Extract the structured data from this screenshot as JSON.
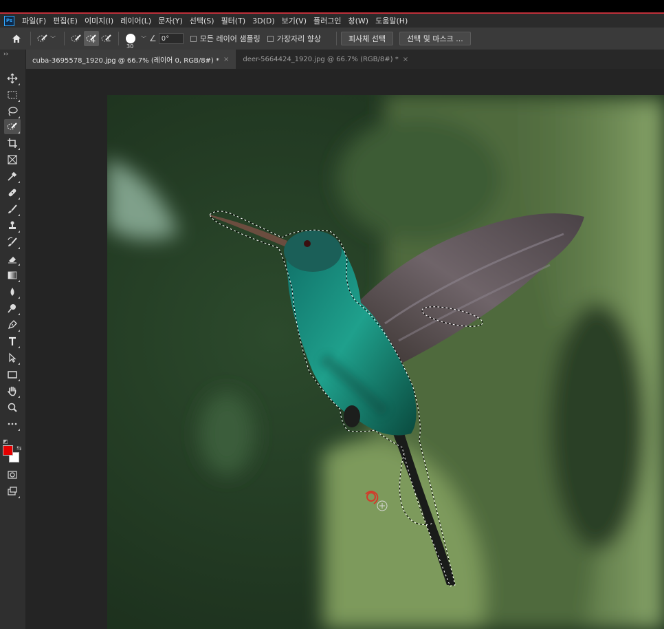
{
  "app": {
    "logo": "Ps"
  },
  "menu": [
    "파일(F)",
    "편집(E)",
    "이미지(I)",
    "레이어(L)",
    "문자(Y)",
    "선택(S)",
    "필터(T)",
    "3D(D)",
    "보기(V)",
    "플러그인",
    "창(W)",
    "도움말(H)"
  ],
  "options": {
    "brush_size": "30",
    "angle": "0°",
    "sample_all_layers": "모든 레이어 샘플링",
    "enhance_edge": "가장자리 향상",
    "select_subject": "피사체 선택",
    "select_and_mask": "선택 및 마스크 ..."
  },
  "tabs": [
    {
      "title": "cuba-3695578_1920.jpg @ 66.7% (레이어 0, RGB/8#) *",
      "close": "×"
    },
    {
      "title": "deer-5664424_1920.jpg @ 66.7% (RGB/8#) *",
      "close": "×"
    }
  ],
  "toolbar": {
    "collapse": "››"
  },
  "colors": {
    "foreground": "#e50000",
    "background": "#ffffff",
    "accent_red": "#c0303a"
  },
  "icons": [
    "home-icon",
    "quick-selection-icon",
    "move-icon",
    "marquee-icon",
    "lasso-icon",
    "crop-icon",
    "frame-icon",
    "eyedropper-icon",
    "healing-icon",
    "brush-icon",
    "stamp-icon",
    "history-brush-icon",
    "eraser-icon",
    "gradient-icon",
    "blur-icon",
    "dodge-icon",
    "pen-icon",
    "type-icon",
    "path-select-icon",
    "rectangle-icon",
    "hand-icon",
    "zoom-icon",
    "more-tools-icon",
    "quick-mask-icon",
    "screen-mode-icon"
  ]
}
